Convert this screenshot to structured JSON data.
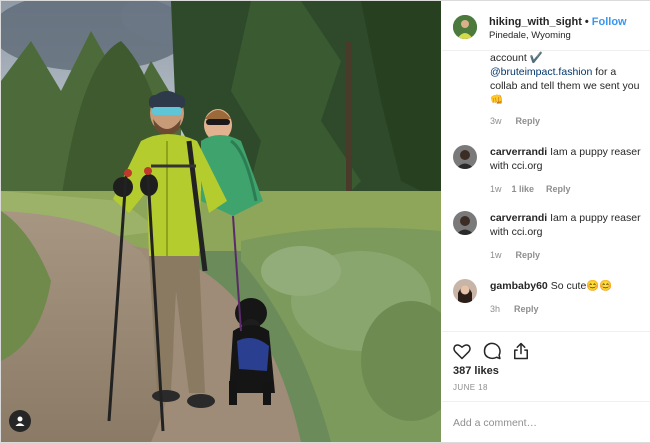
{
  "photo": {
    "alt": "",
    "tag_icon": "user-tag-icon"
  },
  "header": {
    "username": "hiking_with_sight",
    "separator": "•",
    "follow_label": "Follow",
    "location": "Pinedale, Wyoming"
  },
  "comments": [
    {
      "line1": "account ✔️",
      "mention": "@bruteimpact.fashion",
      "rest": " for a collab and tell them we sent you 👊",
      "age": "3w",
      "reply": "Reply"
    },
    {
      "username": "carverrandi",
      "text": "Iam a puppy reaser with cci.org",
      "age": "1w",
      "likes": "1 like",
      "reply": "Reply"
    },
    {
      "username": "carverrandi",
      "text": "Iam a puppy reaser with cci.org",
      "age": "1w",
      "reply": "Reply"
    },
    {
      "username": "gambaby60",
      "text": "So cute😊😊",
      "age": "3h",
      "reply": "Reply"
    }
  ],
  "actions": {
    "like_icon": "heart-icon",
    "comment_icon": "comment-icon",
    "share_icon": "share-icon",
    "likes": "387 likes",
    "date": "JUNE 18"
  },
  "add_comment": {
    "placeholder": "Add a comment…"
  },
  "colors": {
    "link_blue": "#3897f0",
    "mention_blue": "#00376b",
    "meta_grey": "#8e8e8e",
    "border": "#dbdbdb"
  }
}
